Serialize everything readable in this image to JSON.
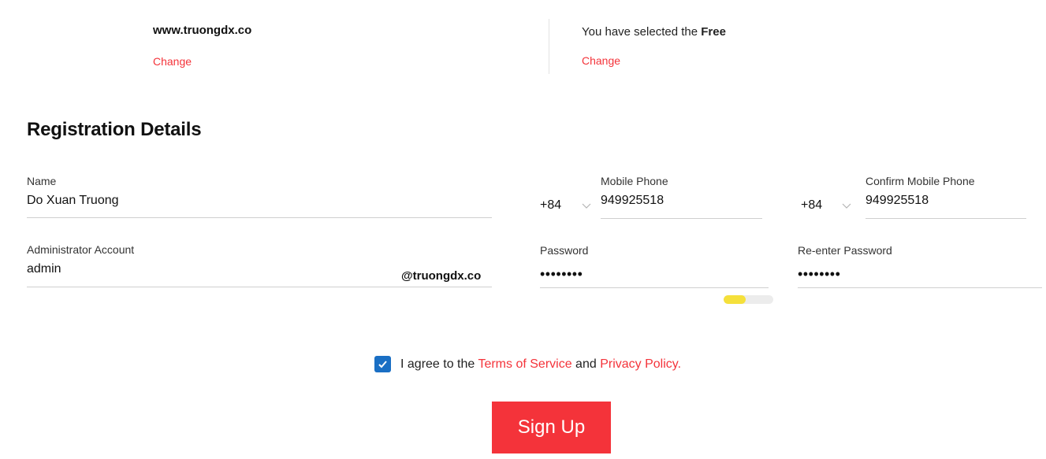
{
  "summary": {
    "domain": "www.truongdx.co",
    "domain_change": "Change",
    "plan_prefix": "You have selected the ",
    "plan_name": "Free",
    "plan_change": "Change"
  },
  "section_title": "Registration Details",
  "form": {
    "name": {
      "label": "Name",
      "value": "Do Xuan Truong"
    },
    "mobile": {
      "label": "Mobile Phone",
      "country_code": "+84",
      "value": "949925518"
    },
    "confirm_mobile": {
      "label": "Confirm Mobile Phone",
      "country_code": "+84",
      "value": "949925518"
    },
    "admin_account": {
      "label": "Administrator Account",
      "value": "admin",
      "suffix": "@truongdx.co"
    },
    "password": {
      "label": "Password",
      "value": "••••••••",
      "strength": 0.45,
      "strength_color": "#f5e03b"
    },
    "reenter_password": {
      "label": "Re-enter Password",
      "value": "••••••••"
    }
  },
  "agreement": {
    "checked": true,
    "prefix": "I agree to the ",
    "terms": "Terms of Service",
    "middle": " and ",
    "privacy": "Privacy Policy",
    "suffix": "."
  },
  "signup_label": "Sign Up",
  "colors": {
    "accent": "#f4333a",
    "checkbox": "#1a6fc4"
  }
}
